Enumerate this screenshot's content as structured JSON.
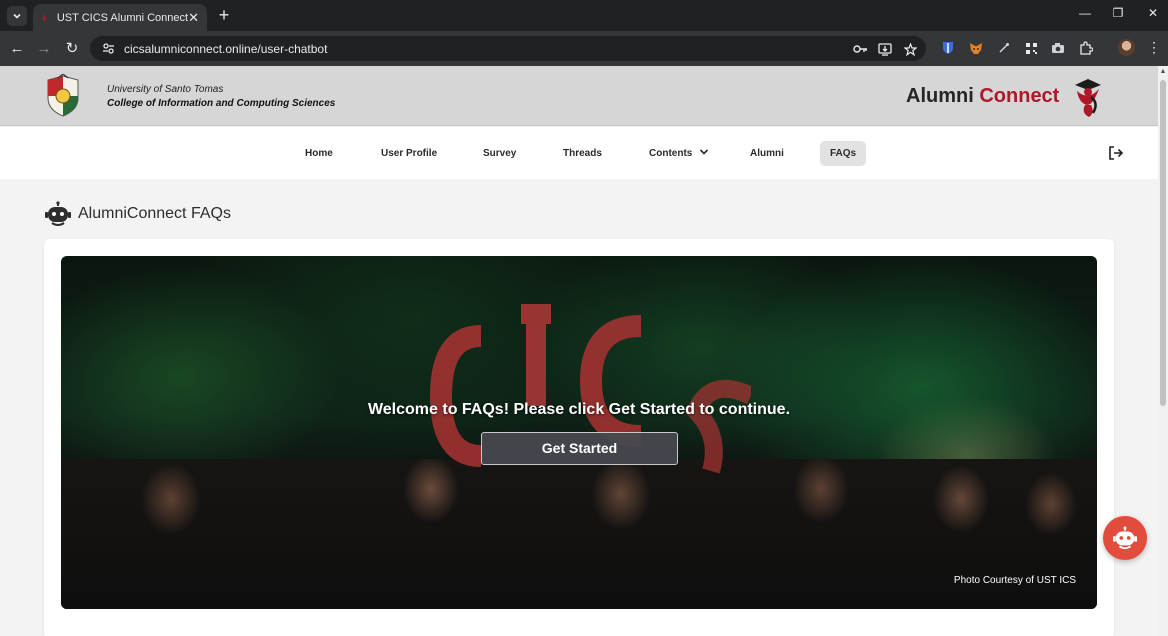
{
  "browser": {
    "tab_title": "UST CICS Alumni Connect",
    "url": "cicsalumniconnect.online/user-chatbot",
    "icons": [
      "tab-search-icon",
      "close-icon",
      "plus-icon",
      "minimize-icon",
      "restore-icon",
      "close-window-icon",
      "back-icon",
      "forward-icon",
      "reload-icon",
      "site-info-icon",
      "password-key-icon",
      "install-app-icon",
      "star-icon",
      "extension-icon",
      "profile-avatar",
      "more-icon"
    ]
  },
  "header": {
    "university": "University of Santo Tomas",
    "college": "College of Information and Computing Sciences",
    "brand_part1": "Alumni",
    "brand_part2": "Connect",
    "brand_colors": {
      "dark": "#262626",
      "accent": "#b0182a"
    }
  },
  "nav": {
    "items": [
      {
        "label": "Home"
      },
      {
        "label": "User Profile"
      },
      {
        "label": "Survey"
      },
      {
        "label": "Threads"
      },
      {
        "label": "Contents"
      },
      {
        "label": "Alumni"
      },
      {
        "label": "FAQs"
      }
    ],
    "active": "FAQs"
  },
  "faq": {
    "title": "AlumniConnect FAQs"
  },
  "hero": {
    "welcome": "Welcome to FAQs! Please click Get Started to continue.",
    "button": "Get Started",
    "credit": "Photo Courtesy of UST ICS"
  },
  "colors": {
    "fab": "#e24c3d",
    "active_nav_bg": "#e2e2e2"
  }
}
